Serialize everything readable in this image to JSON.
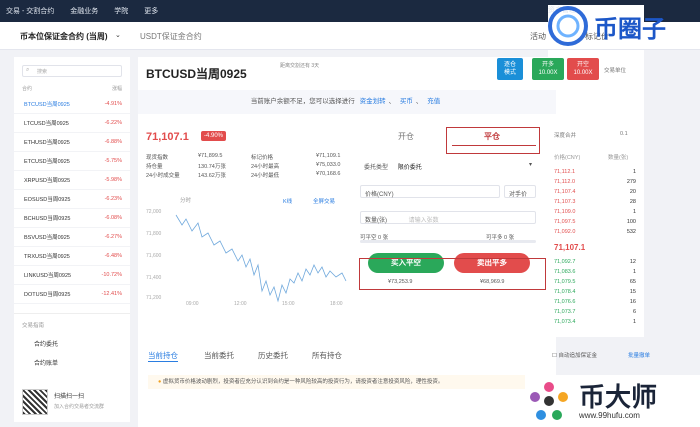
{
  "topnav": {
    "items": [
      "交易 - 交割合约",
      "金融业务",
      "学院",
      "更多"
    ],
    "right": "资产管理"
  },
  "subnav": {
    "tab1": "币本位保证金合约 (当周)",
    "tab2": "USDT保证金合约",
    "extra1": "活动",
    "extra2": "标记价"
  },
  "search": {
    "placeholder": "搜索"
  },
  "list_header": {
    "col1": "合约",
    "col2": "涨幅"
  },
  "contracts": [
    {
      "name": "BTCUSD当周0925",
      "chg": "-4.91%"
    },
    {
      "name": "LTCUSD当周0925",
      "chg": "-6.22%"
    },
    {
      "name": "ETHUSD当周0925",
      "chg": "-6.88%"
    },
    {
      "name": "ETCUSD当周0925",
      "chg": "-5.75%"
    },
    {
      "name": "XRPUSD当周0925",
      "chg": "-5.98%"
    },
    {
      "name": "EOSUSD当周0925",
      "chg": "-6.23%"
    },
    {
      "name": "BCHUSD当周0925",
      "chg": "-6.08%"
    },
    {
      "name": "BSVUSD当周0925",
      "chg": "-6.27%"
    },
    {
      "name": "TRXUSD当周0925",
      "chg": "-6.48%"
    },
    {
      "name": "LINKUSD当周0925",
      "chg": "-10.72%"
    },
    {
      "name": "DOTUSD当周0925",
      "chg": "-12.41%"
    }
  ],
  "left_footer": {
    "guide": "交易指南",
    "link1": "合约委托",
    "link2": "合约账单",
    "qr_title": "扫描扫一扫",
    "qr_sub": "加入合约交易者交流群"
  },
  "main": {
    "title": "BTCUSD当周0925",
    "title_sub": "距离交割还有 3天",
    "notice_text": "当前账户余额不足，您可以选择进行",
    "notice_links": [
      "资金划转",
      "买币",
      "充值"
    ],
    "price": "71,107.1",
    "change": "-4.90%",
    "stats": [
      {
        "label": "现货指数",
        "value": "¥71,899.5",
        "label2": "标记价格",
        "value2": "¥71,109.1"
      },
      {
        "label": "持仓量",
        "value": "130.74万张",
        "label2": "24小时最高",
        "value2": "¥75,033.0"
      },
      {
        "label": "24小时成交量",
        "value": "143.62万张",
        "label2": "24小时最低",
        "value2": "¥70,168.6"
      }
    ],
    "chart_tools": [
      "K线",
      "全屏交易"
    ],
    "chart_tools_left": "分时",
    "chart_yticks": [
      "72,000",
      "71,800",
      "71,600",
      "71,400",
      "71,200"
    ],
    "chart_xticks": [
      "09:00",
      "12:00",
      "15:00",
      "18:00"
    ]
  },
  "badges": [
    {
      "line1": "逐仓",
      "line2": "模式",
      "color": "#1a8fd8"
    },
    {
      "line1": "开多",
      "line2": "10.00X",
      "color": "#2aa85a"
    },
    {
      "line1": "开空",
      "line2": "10.00X",
      "color": "#e24c4c"
    }
  ],
  "badge_extra": "交易单位",
  "trade": {
    "tab_open": "开仓",
    "tab_close": "平仓",
    "order_type_label": "委托类型",
    "order_type_value": "限价委托",
    "price_label": "价格(CNY)",
    "price_suffix": "对手价",
    "qty_label": "数量(张)",
    "qty_placeholder": "请输入张数",
    "can_close_short": "可平空 0 张",
    "can_close_long": "可平多 0 张",
    "btn_buy": "买入平空",
    "btn_sell": "卖出平多",
    "bottom_left": "¥73,253.9",
    "bottom_right": "¥68,969.9"
  },
  "orderbook": {
    "head": "深度合并",
    "head_right": "0.1",
    "col_price": "价格(CNY)",
    "col_qty": "数量(张)",
    "asks": [
      {
        "p": "71,112.1",
        "q": "1"
      },
      {
        "p": "71,112.0",
        "q": "279"
      },
      {
        "p": "71,107.4",
        "q": "20"
      },
      {
        "p": "71,107.3",
        "q": "28"
      },
      {
        "p": "71,109.0",
        "q": "1"
      },
      {
        "p": "71,097.5",
        "q": "100"
      },
      {
        "p": "71,092.0",
        "q": "532"
      }
    ],
    "mid": "71,107.1",
    "bids": [
      {
        "p": "71,092.7",
        "q": "12"
      },
      {
        "p": "71,083.6",
        "q": "1"
      },
      {
        "p": "71,079.5",
        "q": "65"
      },
      {
        "p": "71,078.4",
        "q": "15"
      },
      {
        "p": "71,076.6",
        "q": "16"
      },
      {
        "p": "71,073.7",
        "q": "6"
      },
      {
        "p": "71,073.4",
        "q": "1"
      }
    ]
  },
  "bottom": {
    "tabs": [
      "当前持仓",
      "当前委托",
      "历史委托",
      "所有持仓"
    ],
    "opt1": "自动追加保证金",
    "opt2": "批量撤单",
    "warning": "虚拟货币价格波动剧烈，投资者应充分认识到合约是一种风险较高的投资行为，请投资者注意投资风险，理性投资。"
  },
  "logos": {
    "top": "币圈子",
    "bottom_cn": "币大师",
    "bottom_url": "www.99hufu.com"
  }
}
